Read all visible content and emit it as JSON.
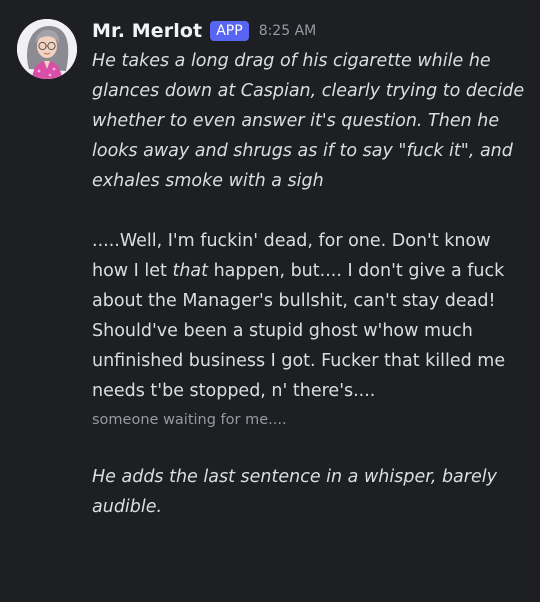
{
  "author": {
    "name": "Mr. Merlot",
    "badge": "APP",
    "timestamp": "8:25 AM",
    "avatar_icon": "avatar-character-portrait"
  },
  "message": {
    "action_1": "He takes a long drag of his cigarette while he glances down at Caspian, clearly trying to decide whether to even answer it's question. Then he looks away and shrugs as if to say \"fuck it\", and exhales smoke with a sigh",
    "speech_part_1": ".....Well, I'm fuckin' dead, for one. Don't know how I let ",
    "speech_emphasis": "that",
    "speech_part_2": " happen, but.... I don't give a fuck about the Manager's bullshit, can't stay dead! Should've been a stupid ghost w'how much unfinished business I got. Fucker that killed me needs t'be stopped, n' there's....",
    "whisper": "someone waiting for me....",
    "action_2": "He adds the last sentence in a whisper, barely audible."
  },
  "colors": {
    "background": "#1e1f22",
    "badge": "#5865f2",
    "text": "#dbdee1",
    "muted": "#949ba4"
  }
}
